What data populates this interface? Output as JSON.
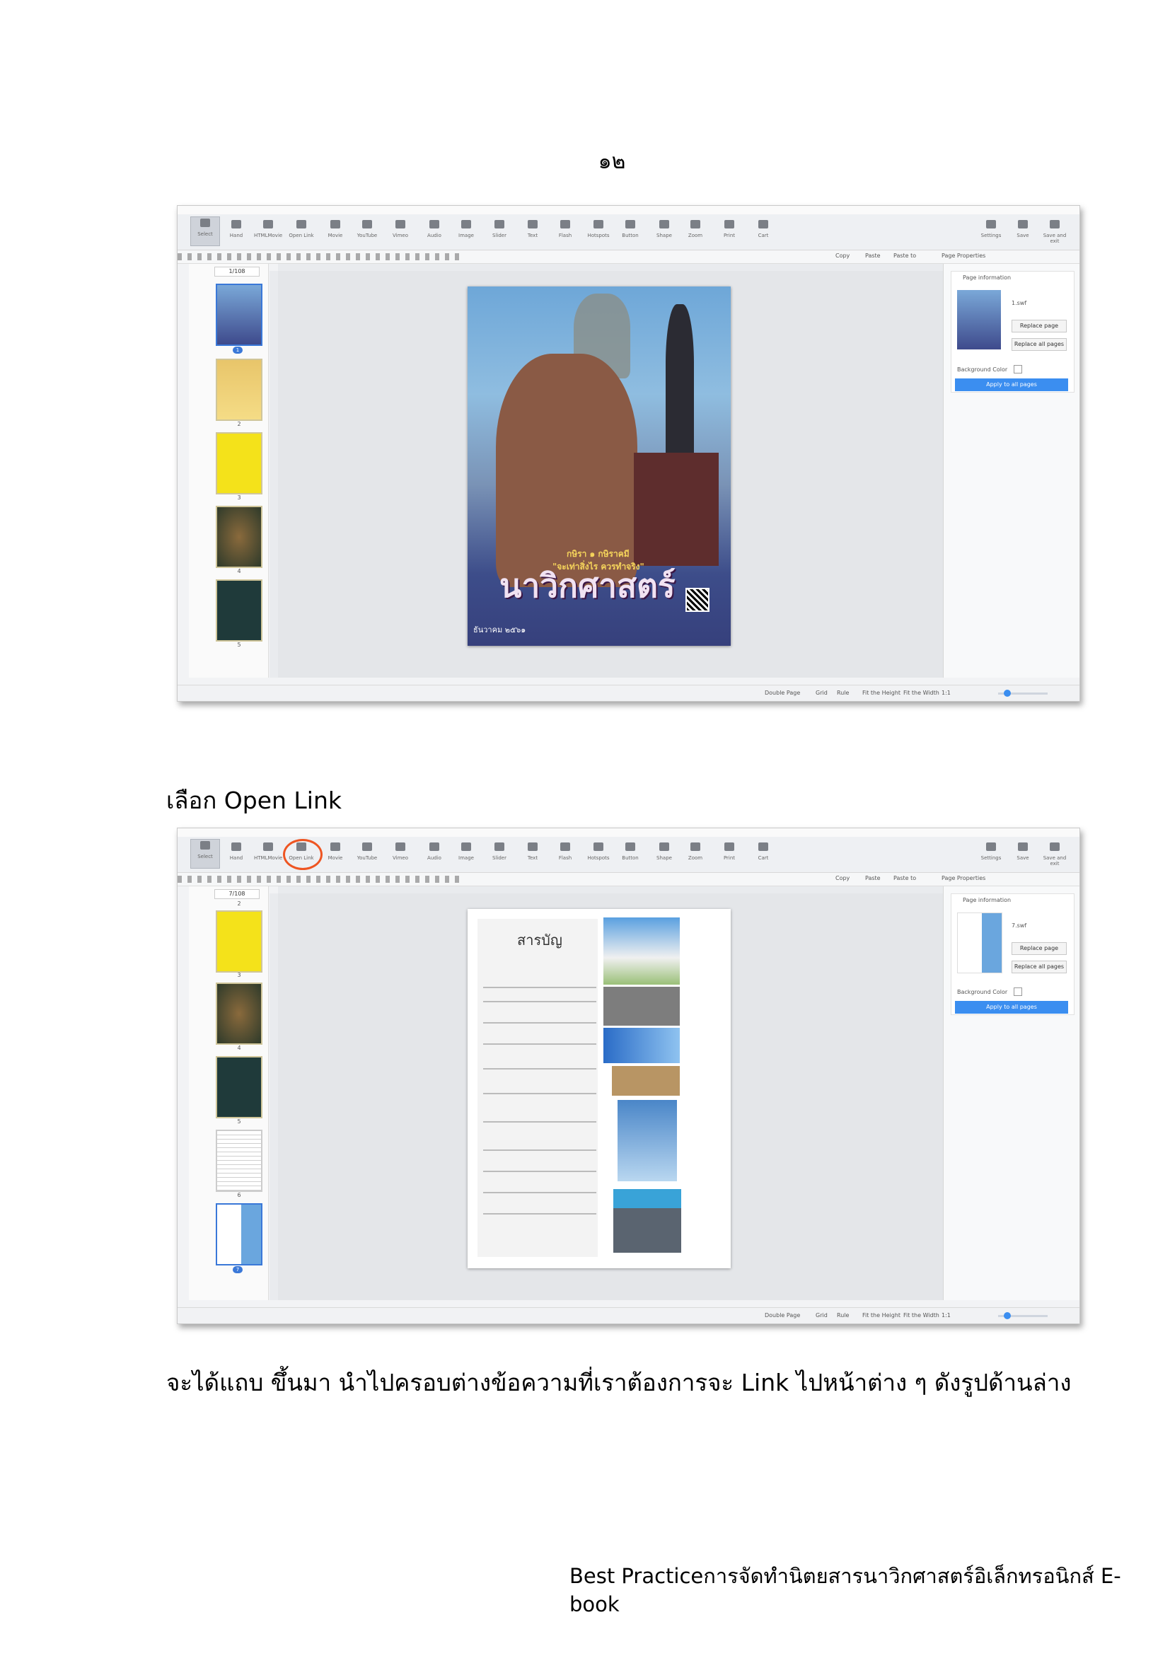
{
  "page_number": "๑๒",
  "caption_1": "เลือก Open Link",
  "caption_2": "จะได้แถบ ขึ้นมา นำไปครอบต่างข้อความที่เราต้องการจะ Link ไปหน้าต่าง ๆ ดังรูปด้านล่าง",
  "footer": "Best Practiceการจัดทำนิตยสารนาวิกศาสตร์อิเล็กทรอนิกส์ E-book",
  "toolbar": [
    {
      "name": "select",
      "label": "Select"
    },
    {
      "name": "hand",
      "label": "Hand"
    },
    {
      "name": "html-movie",
      "label": "HTMLMovie"
    },
    {
      "name": "open-link",
      "label": "Open Link"
    },
    {
      "name": "movie",
      "label": "Movie"
    },
    {
      "name": "youtube",
      "label": "YouTube"
    },
    {
      "name": "vimeo",
      "label": "Vimeo"
    },
    {
      "name": "audio",
      "label": "Audio"
    },
    {
      "name": "image",
      "label": "Image"
    },
    {
      "name": "slider",
      "label": "Slider"
    },
    {
      "name": "text",
      "label": "Text"
    },
    {
      "name": "flash",
      "label": "Flash"
    },
    {
      "name": "hotspots",
      "label": "Hotspots"
    },
    {
      "name": "button",
      "label": "Button"
    },
    {
      "name": "shape",
      "label": "Shape"
    },
    {
      "name": "zoom",
      "label": "Zoom"
    },
    {
      "name": "print",
      "label": "Print"
    },
    {
      "name": "cart",
      "label": "Cart"
    }
  ],
  "toolbar_right": [
    {
      "name": "settings",
      "label": "Settings"
    },
    {
      "name": "save",
      "label": "Save"
    },
    {
      "name": "save-and-exit",
      "label": "Save and exit"
    }
  ],
  "edit_actions": {
    "copy": "Copy",
    "paste": "Paste",
    "paste_to": "Paste to"
  },
  "page_properties": {
    "title": "Page Properties",
    "section": "Page information",
    "replace_page": "Replace page",
    "replace_all": "Replace all pages",
    "bg_color": "Background Color",
    "apply": "Apply to all pages"
  },
  "status": {
    "double_page": "Double Page",
    "grid": "Grid",
    "rule": "Rule",
    "fit_height": "Fit the Height",
    "fit_width": "Fit the Width",
    "ratio": "1:1"
  },
  "shot1": {
    "page_counter": "1/108",
    "file_name": "1.swf",
    "thumb_labels": [
      "1",
      "2",
      "3",
      "4",
      "5"
    ],
    "cover": {
      "subtitle_1": "กษิรา ๑ กษิราคมี",
      "subtitle_2": "\"จะเท่าสิ่งไร ควรทำจริง\"",
      "title": "นาวิกศาสตร์",
      "date": "ธันวาคม ๒๕๖๑"
    }
  },
  "shot2": {
    "page_counter": "7/108",
    "file_name": "7.swf",
    "thumb_labels": [
      "2",
      "3",
      "4",
      "5",
      "6",
      "7"
    ],
    "toc_title": "สารบัญ"
  },
  "colors": {
    "accent": "#3b8ef0",
    "highlight_ring": "#ee5522"
  }
}
